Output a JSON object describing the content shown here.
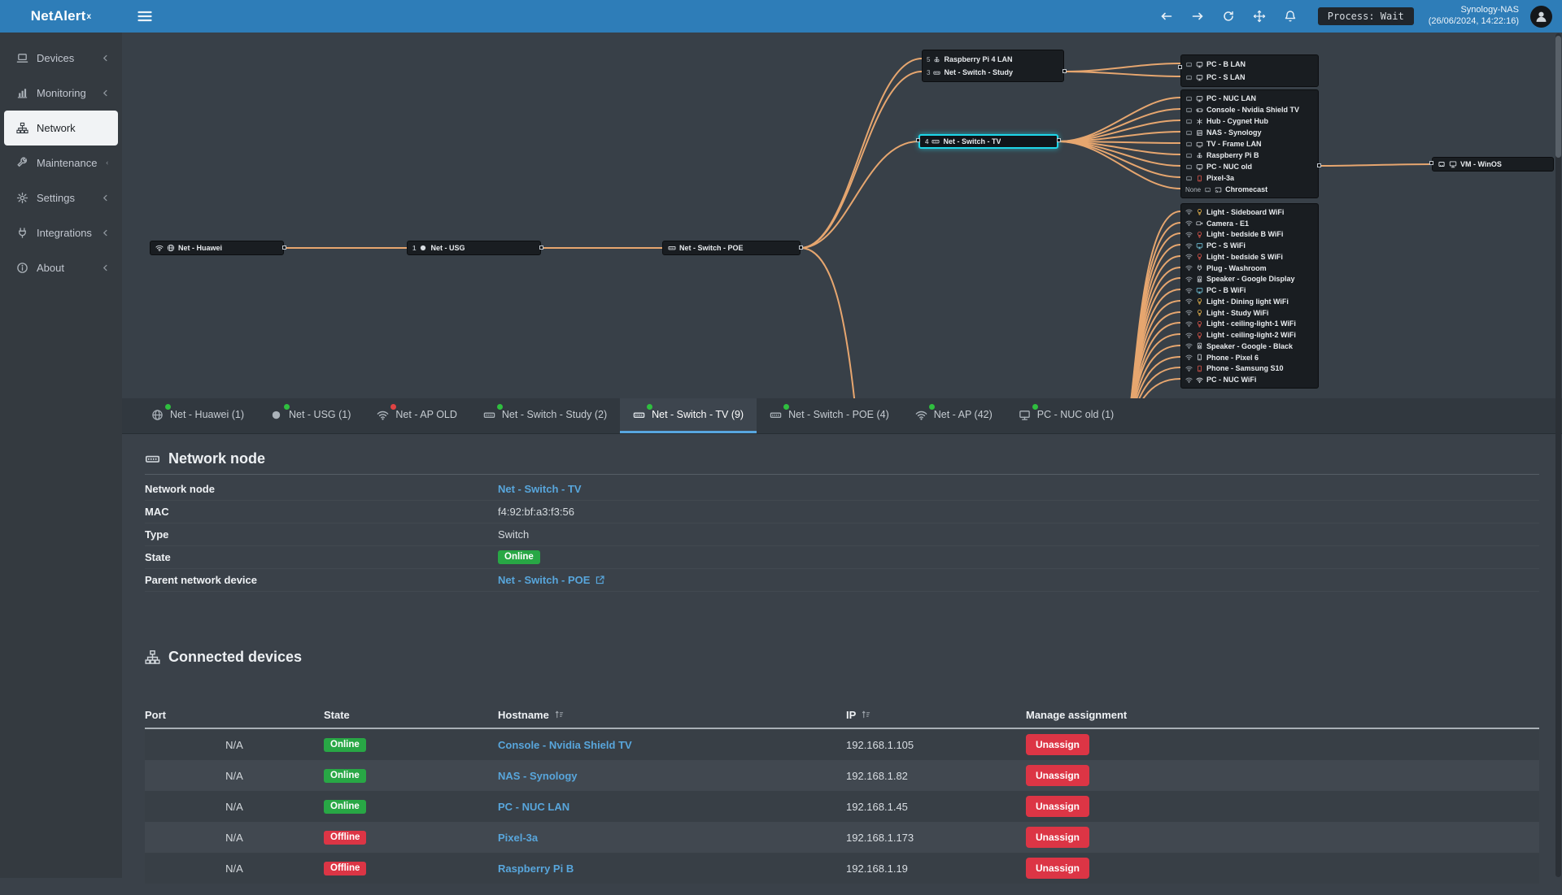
{
  "header": {
    "brand": "NetAlert",
    "brand_sup": "x",
    "process_label": "Process: Wait",
    "server_name": "Synology-NAS",
    "server_time": "(26/06/2024, 14:22:16)",
    "nav_icons": [
      {
        "icon": "arrow-left",
        "name": "back-icon"
      },
      {
        "icon": "arrow-right",
        "name": "forward-icon"
      },
      {
        "icon": "refresh",
        "name": "refresh-icon"
      },
      {
        "icon": "move",
        "name": "move-icon"
      },
      {
        "icon": "bell",
        "name": "notifications-icon"
      }
    ]
  },
  "sidebar": {
    "items": [
      {
        "label": "Devices",
        "icon": "laptop",
        "chevron": "chevleft"
      },
      {
        "label": "Monitoring",
        "icon": "chart",
        "chevron": "chevleft"
      },
      {
        "label": "Network",
        "icon": "sitemap",
        "active": true
      },
      {
        "label": "Maintenance",
        "icon": "wrench",
        "chevron": "chevleft"
      },
      {
        "label": "Settings",
        "icon": "gear",
        "chevron": "chevleft"
      },
      {
        "label": "Integrations",
        "icon": "plug",
        "chevron": "chevleft"
      },
      {
        "label": "About",
        "icon": "info",
        "chevron": "chevleft"
      }
    ]
  },
  "topology": {
    "huawei": {
      "label": "Net - Huawei"
    },
    "usg": {
      "label": "Net - USG",
      "port": "1"
    },
    "poe": {
      "label": "Net - Switch - POE"
    },
    "tv": {
      "label": "Net - Switch - TV",
      "port": "4"
    },
    "vm": {
      "label": "VM - WinOS"
    },
    "box_study": {
      "rows": [
        {
          "port": "5",
          "icon": "pi",
          "label": "Raspberry Pi 4 LAN"
        },
        {
          "port": "3",
          "icon": "eth",
          "label": "Net - Switch - Study"
        }
      ]
    },
    "box_pcs": {
      "rows": [
        {
          "lead": "eport",
          "icon": "pc",
          "label": "PC - B LAN"
        },
        {
          "lead": "eport",
          "icon": "pc",
          "label": "PC - S LAN"
        }
      ]
    },
    "box_tv": {
      "rows": [
        {
          "lead": "eport",
          "icon": "pc",
          "label": "PC - NUC LAN"
        },
        {
          "lead": "eport",
          "icon": "gamepad",
          "label": "Console - Nvidia Shield TV"
        },
        {
          "lead": "eport",
          "icon": "hub",
          "label": "Hub - Cygnet Hub"
        },
        {
          "lead": "eport",
          "icon": "nas",
          "label": "NAS - Synology"
        },
        {
          "lead": "eport",
          "icon": "tv",
          "label": "TV - Frame LAN"
        },
        {
          "lead": "eport",
          "icon": "pi",
          "label": "Raspberry Pi B"
        },
        {
          "lead": "eport",
          "icon": "pc",
          "label": "PC - NUC old"
        },
        {
          "lead": "eport",
          "icon": "phone",
          "label": "Pixel-3a",
          "color": "#e2574c"
        },
        {
          "port": "None",
          "lead": "eport",
          "icon": "cast",
          "label": "Chromecast"
        }
      ]
    },
    "box_wifi": {
      "rows": [
        {
          "lead": "wifi",
          "icon": "bulb",
          "label": "Light - Sideboard WiFi",
          "color": "#eab64f"
        },
        {
          "lead": "wifi",
          "icon": "camera",
          "label": "Camera - E1"
        },
        {
          "lead": "wifi",
          "icon": "bulb",
          "label": "Light - bedside B WiFi",
          "color": "#e2574c"
        },
        {
          "lead": "wifi",
          "icon": "pc",
          "label": "PC - S WiFi",
          "color": "#74c7dd"
        },
        {
          "lead": "wifi",
          "icon": "bulb",
          "label": "Light - bedside S WiFi",
          "color": "#e2574c"
        },
        {
          "lead": "wifi",
          "icon": "plug",
          "label": "Plug - Washroom"
        },
        {
          "lead": "wifi",
          "icon": "speaker",
          "label": "Speaker - Google Display"
        },
        {
          "lead": "wifi",
          "icon": "pc",
          "label": "PC - B WiFi",
          "color": "#74c7dd"
        },
        {
          "lead": "wifi",
          "icon": "bulb",
          "label": "Light - Dining light WiFi",
          "color": "#eab64f"
        },
        {
          "lead": "wifi",
          "icon": "bulb",
          "label": "Light - Study WiFi",
          "color": "#eab64f"
        },
        {
          "lead": "wifi",
          "icon": "bulb",
          "label": "Light - ceiling-light-1 WiFi",
          "color": "#e2574c"
        },
        {
          "lead": "wifi",
          "icon": "bulb",
          "label": "Light - ceiling-light-2 WiFi",
          "color": "#e2574c"
        },
        {
          "lead": "wifi",
          "icon": "speaker",
          "label": "Speaker - Google - Black"
        },
        {
          "lead": "wifi",
          "icon": "phone",
          "label": "Phone - Pixel 6"
        },
        {
          "lead": "wifi",
          "icon": "phone",
          "label": "Phone - Samsung S10",
          "color": "#e2574c"
        },
        {
          "lead": "wifi",
          "icon": "wifi",
          "label": "PC - NUC WiFi"
        }
      ]
    }
  },
  "tabs": [
    {
      "label": "Net - Huawei (1)",
      "icon": "globe",
      "dot": "#2fbe3f"
    },
    {
      "label": "Net - USG (1)",
      "icon": "router",
      "dot": "#2fbe3f"
    },
    {
      "label": "Net - AP OLD",
      "icon": "wifi",
      "dot": "#e04343"
    },
    {
      "label": "Net - Switch - Study (2)",
      "icon": "eth",
      "dot": "#2fbe3f"
    },
    {
      "label": "Net - Switch - TV (9)",
      "icon": "eth",
      "dot": "#2fbe3f",
      "active": true
    },
    {
      "label": "Net - Switch - POE (4)",
      "icon": "eth",
      "dot": "#2fbe3f"
    },
    {
      "label": "Net - AP (42)",
      "icon": "wifi",
      "dot": "#2fbe3f"
    },
    {
      "label": "PC - NUC old (1)",
      "icon": "pc",
      "dot": "#2fbe3f"
    }
  ],
  "node_panel": {
    "title": "Network node",
    "fields": [
      {
        "label": "Network node",
        "value": "Net - Switch - TV"
      },
      {
        "label": "MAC",
        "value": "f4:92:bf:a3:f3:56"
      },
      {
        "label": "Type",
        "value": "Switch"
      },
      {
        "label": "State",
        "value": "Online"
      },
      {
        "label": "Parent network device",
        "value": "Net - Switch - POE"
      }
    ]
  },
  "connected": {
    "title": "Connected devices",
    "columns": [
      "Port",
      "State",
      "Hostname",
      "IP",
      "Manage assignment"
    ],
    "unassign_label": "Unassign",
    "rows": [
      {
        "port": "N/A",
        "state": "Online",
        "hostname": "Console - Nvidia Shield TV",
        "ip": "192.168.1.105"
      },
      {
        "port": "N/A",
        "state": "Online",
        "hostname": "NAS - Synology",
        "ip": "192.168.1.82"
      },
      {
        "port": "N/A",
        "state": "Online",
        "hostname": "PC - NUC LAN",
        "ip": "192.168.1.45"
      },
      {
        "port": "N/A",
        "state": "Offline",
        "hostname": "Pixel-3a",
        "ip": "192.168.1.173"
      },
      {
        "port": "N/A",
        "state": "Offline",
        "hostname": "Raspberry Pi B",
        "ip": "192.168.1.19"
      }
    ]
  }
}
